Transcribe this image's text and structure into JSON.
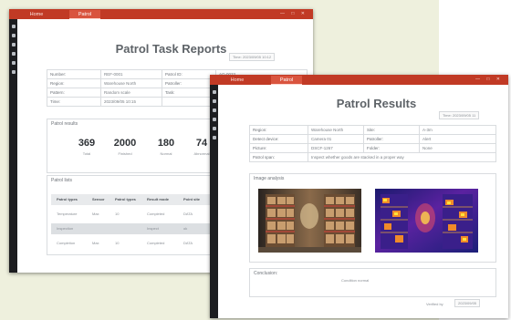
{
  "task_window": {
    "tabs": [
      "Home",
      "Patrol"
    ],
    "window_controls": "— □ ✕",
    "sidebar_icons": [
      "menu-icon",
      "user-icon",
      "map-icon",
      "device-icon",
      "settings-icon",
      "info-icon"
    ],
    "title": "Patrol Task Reports",
    "time_stamp": "Time: 2023/09/05 10:12",
    "info": [
      [
        "Number:",
        "REF-0001",
        "Patrol ID:",
        "AG-0033"
      ],
      [
        "Region:",
        "Warehouse North",
        "Patroller:",
        ""
      ],
      [
        "Pattern:",
        "Random scale",
        "Task:",
        ""
      ],
      [
        "Time:",
        "2023/09/05 10:15",
        "",
        ""
      ]
    ],
    "results_title": "Patrol results",
    "stats": [
      {
        "value": "369",
        "label": "Total"
      },
      {
        "value": "2000",
        "label": "Finished"
      },
      {
        "value": "180",
        "label": "Normal"
      },
      {
        "value": "74",
        "label": "Abnormal"
      }
    ],
    "list_title": "Patrol lists",
    "list_headers": [
      "Patrol types",
      "Sensor",
      "Patrol types",
      "Result mode",
      "Point site"
    ],
    "list_rows": [
      [
        "Temperature",
        "Max",
        "10",
        "Completed",
        "DATA"
      ],
      [
        "Inspection",
        "",
        "",
        "Inspect",
        "ok"
      ],
      [
        "Completion",
        "Max",
        "10",
        "Completed",
        "DATA"
      ]
    ]
  },
  "result_window": {
    "tabs": [
      "Home",
      "Patrol"
    ],
    "window_controls": "— □ ✕",
    "sidebar_icons": [
      "menu-icon",
      "user-icon",
      "map-icon",
      "device-icon",
      "settings-icon",
      "info-icon"
    ],
    "title": "Patrol Results",
    "time_stamp": "Time: 2023/09/05 11",
    "info": [
      [
        "Region:",
        "Warehouse North",
        "Site:",
        "A-3m"
      ],
      [
        "Detect device:",
        "Camera 01",
        "Patroller:",
        "Alert"
      ],
      [
        "Picture:",
        "DSCF-1267",
        "Folder:",
        "None"
      ]
    ],
    "patrol_span_label": "Patrol span:",
    "patrol_span_value": "Inspect whether goods are stacked in a proper way",
    "image_analysis_title": "Image analysis",
    "conclusion_label": "Conclusion:",
    "conclusion_value": "Condition normal",
    "footer_left": "Verified by",
    "footer_right": "2023/09/05"
  },
  "colors": {
    "titlebar": "#c13a25",
    "sidebar": "#1c1d20",
    "backdrop": "#eef0dd"
  }
}
